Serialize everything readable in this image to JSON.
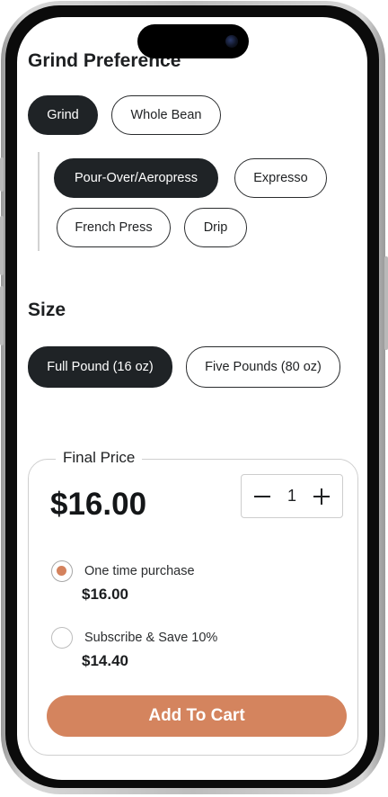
{
  "grind": {
    "title": "Grind Preference",
    "options": [
      "Grind",
      "Whole Bean"
    ],
    "selected": "Grind",
    "methods": [
      "Pour-Over/Aeropress",
      "Expresso",
      "French Press",
      "Drip"
    ],
    "selected_method": "Pour-Over/Aeropress"
  },
  "size": {
    "title": "Size",
    "options": [
      "Full Pound (16 oz)",
      "Five Pounds (80 oz)"
    ],
    "selected": "Full Pound (16 oz)"
  },
  "price_card": {
    "legend": "Final Price",
    "final_price": "$16.00",
    "quantity": "1",
    "purchase_options": [
      {
        "label": "One time purchase",
        "price": "$16.00",
        "selected": true
      },
      {
        "label": "Subscribe & Save 10%",
        "price": "$14.40",
        "selected": false
      }
    ],
    "add_to_cart": "Add To Cart"
  },
  "colors": {
    "accent": "#d4845e",
    "dark_pill": "#1f2326"
  }
}
